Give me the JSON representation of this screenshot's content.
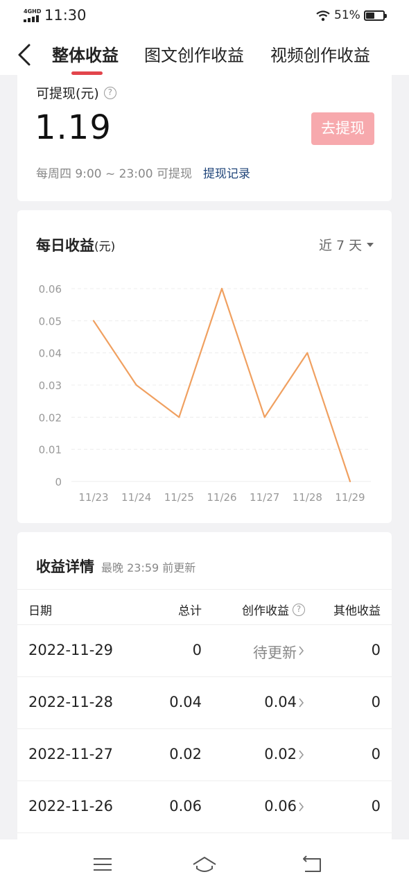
{
  "status_bar": {
    "network": "4GHD",
    "time": "11:30",
    "battery_percent": "51%",
    "battery_level": 0.51
  },
  "nav": {
    "tabs": [
      {
        "label": "整体收益",
        "active": true
      },
      {
        "label": "图文创作收益",
        "active": false
      },
      {
        "label": "视频创作收益",
        "active": false
      }
    ]
  },
  "withdraw": {
    "label": "可提现(元)",
    "amount": "1.19",
    "button": "去提现",
    "note": "每周四 9:00 ~ 23:00 可提现",
    "record_link": "提现记录"
  },
  "daily": {
    "title": "每日收益",
    "unit": "(元)",
    "range": "近 7 天"
  },
  "chart_data": {
    "type": "line",
    "categories": [
      "11/23",
      "11/24",
      "11/25",
      "11/26",
      "11/27",
      "11/28",
      "11/29"
    ],
    "values": [
      0.05,
      0.03,
      0.02,
      0.06,
      0.02,
      0.04,
      0
    ],
    "y_ticks": [
      "0.06",
      "0.05",
      "0.04",
      "0.03",
      "0.02",
      "0.01",
      "0"
    ],
    "ylim": [
      0,
      0.06
    ],
    "grid": true,
    "line_color": "#f0a060"
  },
  "details": {
    "title": "收益详情",
    "subtitle": "最晚 23:59 前更新",
    "columns": [
      "日期",
      "总计",
      "创作收益",
      "其他收益"
    ],
    "rows": [
      {
        "date": "2022-11-29",
        "total": "0",
        "creation": "待更新",
        "other": "0"
      },
      {
        "date": "2022-11-28",
        "total": "0.04",
        "creation": "0.04",
        "other": "0"
      },
      {
        "date": "2022-11-27",
        "total": "0.02",
        "creation": "0.02",
        "other": "0"
      },
      {
        "date": "2022-11-26",
        "total": "0.06",
        "creation": "0.06",
        "other": "0"
      }
    ]
  },
  "colors": {
    "accent": "#e2454c",
    "button_disabled": "#f7a9ad",
    "link": "#20457a"
  },
  "icons": {
    "back": "chevron-left-icon",
    "help": "question-circle-icon",
    "menu": "menu-icon",
    "home": "home-icon",
    "return": "return-icon"
  }
}
